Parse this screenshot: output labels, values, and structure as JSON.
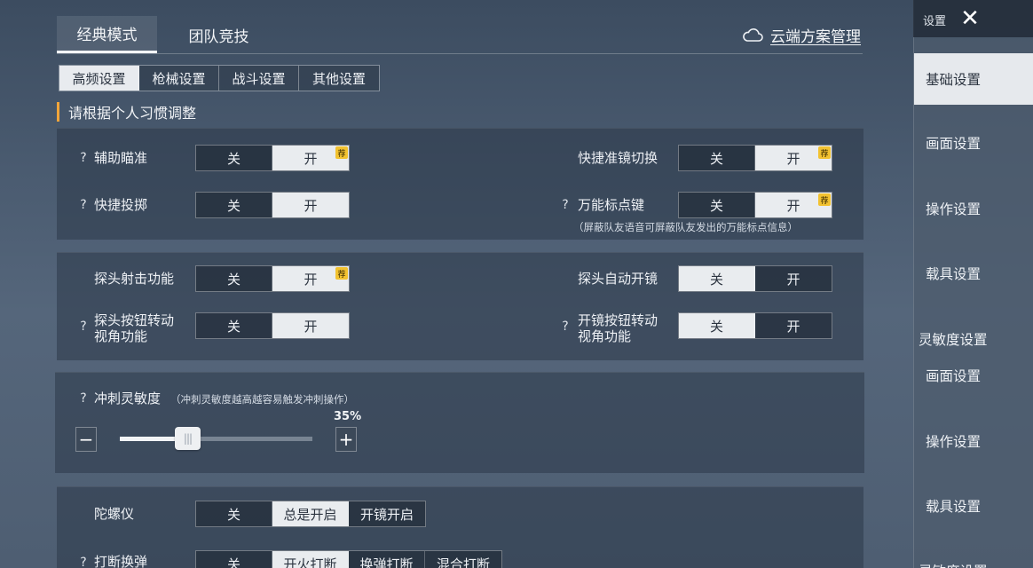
{
  "mode_tabs": [
    {
      "label": "经典模式",
      "active": true
    },
    {
      "label": "团队竞技",
      "active": false
    }
  ],
  "cloud": {
    "icon": "cloud-icon",
    "label": "云端方案管理"
  },
  "sub_tabs": [
    {
      "label": "高频设置",
      "active": true
    },
    {
      "label": "枪械设置",
      "active": false
    },
    {
      "label": "战斗设置",
      "active": false
    },
    {
      "label": "其他设置",
      "active": false
    }
  ],
  "section_title": "请根据个人习惯调整",
  "toggle_off": "关",
  "toggle_on": "开",
  "recommend_badge": "荐",
  "help_mark": "?",
  "settings": {
    "aim_assist": {
      "label": "辅助瞄准",
      "value": "开",
      "recommended": true
    },
    "quick_scope": {
      "label": "快捷准镜切换",
      "value": "开",
      "recommended": true
    },
    "quick_throw": {
      "label": "快捷投掷",
      "value": "开",
      "recommended": false
    },
    "universal_mark": {
      "label": "万能标点键",
      "value": "开",
      "recommended": true,
      "note": "（屏蔽队友语音可屏蔽队友发出的万能标点信息）"
    },
    "peek_fire": {
      "label": "探头射击功能",
      "value": "开",
      "recommended": true
    },
    "peek_auto_scope": {
      "label": "探头自动开镜",
      "value": "关",
      "recommended": false
    },
    "peek_button_rotate": {
      "label_line1": "探头按钮转动",
      "label_line2": "视角功能",
      "value": "开"
    },
    "scope_button_rotate": {
      "label_line1": "开镜按钮转动",
      "label_line2": "视角功能",
      "value": "关"
    }
  },
  "sprint_sensitivity": {
    "label": "冲刺灵敏度",
    "note": "（冲刺灵敏度越高越容易触发冲刺操作）",
    "value_percent": 35,
    "value_text": "35%",
    "minus": "−",
    "plus": "+"
  },
  "gyroscope": {
    "label": "陀螺仪",
    "options": [
      "关",
      "总是开启",
      "开镜开启"
    ],
    "selected": "总是开启"
  },
  "reload_interrupt": {
    "label": "打断换弹",
    "options": [
      "关",
      "开火打断",
      "换弹打断",
      "混合打断"
    ],
    "selected": "开火打断"
  },
  "sidebar": {
    "title": "设置",
    "close_icon": "close-icon",
    "items": [
      {
        "label": "基础设置",
        "active": true
      },
      {
        "label": "画面设置",
        "active": false
      },
      {
        "label": "操作设置",
        "active": false
      },
      {
        "label": "载具设置",
        "active": false
      },
      {
        "label": "灵敏度设置",
        "active": false
      },
      {
        "label": "画面设置",
        "active": false
      },
      {
        "label": "操作设置",
        "active": false
      },
      {
        "label": "载具设置",
        "active": false
      },
      {
        "label": "灵敏度设置",
        "active": false
      }
    ]
  }
}
